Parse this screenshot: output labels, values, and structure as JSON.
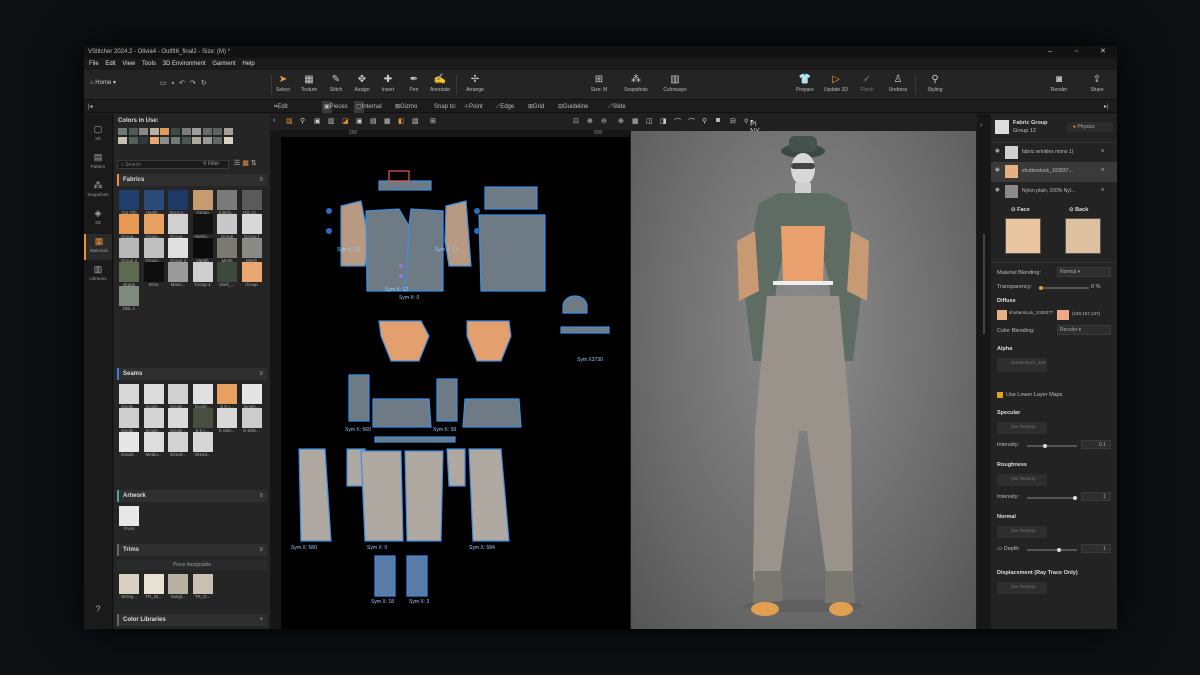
{
  "window": {
    "title": "VStitcher 2024.2 - Olivia4 - Outfit6_final2 - Size: (M) *"
  },
  "menu": [
    "File",
    "Edit",
    "View",
    "Tools",
    "3D Environment",
    "Garment",
    "Help"
  ],
  "toolbar": {
    "home": "Home",
    "tools": [
      {
        "label": "Select",
        "icon": "cursor-icon"
      },
      {
        "label": "Texture",
        "icon": "texture-icon"
      },
      {
        "label": "Stitch",
        "icon": "stitch-icon"
      },
      {
        "label": "Assign",
        "icon": "assign-icon"
      },
      {
        "label": "Insert",
        "icon": "insert-icon"
      },
      {
        "label": "Pen",
        "icon": "pen-icon"
      },
      {
        "label": "Annotate",
        "icon": "annotate-icon"
      },
      {
        "label": "Arrange",
        "icon": "arrange-icon"
      }
    ],
    "right_tools": [
      {
        "label": "Size: M",
        "icon": "size-icon"
      },
      {
        "label": "Snapshots",
        "icon": "snapshots-icon"
      },
      {
        "label": "Colorways",
        "icon": "colorways-icon"
      },
      {
        "label": "Prepare",
        "icon": "prepare-icon"
      },
      {
        "label": "Update 3D",
        "icon": "update-icon"
      },
      {
        "label": "Finish",
        "icon": "finish-icon"
      },
      {
        "label": "Undress",
        "icon": "undress-icon"
      },
      {
        "label": "Styling",
        "icon": "styling-icon"
      },
      {
        "label": "Render",
        "icon": "render-icon"
      },
      {
        "label": "Share",
        "icon": "share-icon"
      }
    ]
  },
  "subbar": {
    "edit_points": "Edit Points",
    "pieces": "Pieces",
    "internal": "Internal",
    "gizmo": "Gizmo",
    "snap_to": "Snap to:",
    "point": "Point",
    "edge": "Edge",
    "grid": "Grid",
    "guideline": "Guideline",
    "slide": "Slide"
  },
  "leftbar": [
    {
      "label": "2D",
      "icon": "2d-icon"
    },
    {
      "label": "Pattern",
      "icon": "pattern-icon"
    },
    {
      "label": "Snapshots",
      "icon": "camera-icon"
    },
    {
      "label": "3D",
      "icon": "3d-icon"
    },
    {
      "label": "Materials",
      "icon": "materials-icon"
    },
    {
      "label": "Libraries",
      "icon": "libraries-icon"
    }
  ],
  "library": {
    "colors_title": "Colors in Use:",
    "colors": [
      "#6d7a72",
      "#4d5a55",
      "#8a8a82",
      "#b8b0a4",
      "#e09a5a",
      "#3d4a4a",
      "#7a7f7a",
      "#9aa09a",
      "#6a6a6a",
      "#5a6560",
      "#a8a098",
      "#c8c0b0",
      "#55605c",
      "#2f3a3a",
      "#e8a870",
      "#8d8d8d",
      "#707a76",
      "#4a5652",
      "#b0a898",
      "#9a9a92",
      "#606a66",
      "#d8d0c0"
    ],
    "search_placeholder": "Search",
    "filter": "Filter",
    "fabrics_title": "Fabrics",
    "fabrics": [
      {
        "label": "2x2 Rib",
        "color": "#1e3f6a"
      },
      {
        "label": "Heath...",
        "color": "#2a4a78"
      },
      {
        "label": "Seccor...",
        "color": "#1d3a66"
      },
      {
        "label": "Group",
        "color": "#c89a70"
      },
      {
        "label": "Interlo...",
        "color": "#7a7a7a"
      },
      {
        "label": "Rib 2x...",
        "color": "#5a5a5a"
      },
      {
        "label": "Group...",
        "color": "#e89a55"
      },
      {
        "label": "Group...",
        "color": "#e8a060"
      },
      {
        "label": "Group...",
        "color": "#d0d0d0"
      },
      {
        "label": "Interlo...",
        "color": "#101010"
      },
      {
        "label": "Group",
        "color": "#c8c8c8"
      },
      {
        "label": "Group f",
        "color": "#d8d8d8"
      },
      {
        "label": "Group 2",
        "color": "#b8b8b8"
      },
      {
        "label": "Group...",
        "color": "#c0c0c0"
      },
      {
        "label": "Group 3",
        "color": "#e0e0e0"
      },
      {
        "label": "Heath",
        "color": "#0a0a0a"
      },
      {
        "label": "Mesh",
        "color": "#7a7a72"
      },
      {
        "label": "Mesh",
        "color": "#8a8a84"
      },
      {
        "label": "straps",
        "color": "#5c6a50"
      },
      {
        "label": "trims",
        "color": "#0e0e0e"
      },
      {
        "label": "Mans...",
        "color": "#9a9a9a"
      },
      {
        "label": "Group 4",
        "color": "#cfcfcf"
      },
      {
        "label": "shell_...",
        "color": "#3c4a3c"
      },
      {
        "label": "Group",
        "color": "#e8a870"
      },
      {
        "label": "DBL 1",
        "color": "#7e8a7e"
      }
    ],
    "seams_title": "Seams",
    "seams": [
      {
        "label": "Single...",
        "color": "#d8d8d8"
      },
      {
        "label": "Single...",
        "color": "#dcdcdc"
      },
      {
        "label": "Single...",
        "color": "#d0d0d0"
      },
      {
        "label": "Doubl...",
        "color": "#e0e0e0"
      },
      {
        "label": "S 8 c...",
        "color": "#e8a060"
      },
      {
        "label": "Single...",
        "color": "#e4e4e4"
      },
      {
        "label": "Single...",
        "color": "#cfcfcf"
      },
      {
        "label": "Single...",
        "color": "#d4d4d4"
      },
      {
        "label": "Single...",
        "color": "#dadada"
      },
      {
        "label": "6 8 c...",
        "color": "#4a4e3e"
      },
      {
        "label": "S Stitc...",
        "color": "#d8d8d8"
      },
      {
        "label": "S Stitc...",
        "color": "#cccccc"
      },
      {
        "label": "Doubl...",
        "color": "#e6e6e6"
      },
      {
        "label": "Mediu...",
        "color": "#dddddd"
      },
      {
        "label": "401ed...",
        "color": "#d2d2d2"
      },
      {
        "label": "401ed...",
        "color": "#d6d6d6"
      }
    ],
    "artwork_title": "Artwork",
    "artwork": [
      {
        "label": "Front",
        "color": "#e8e8e8"
      }
    ],
    "trims_title": "Trims",
    "trims_sub": "Piece Assignable",
    "trims": [
      {
        "label": "String...",
        "color": "#d8d0c0"
      },
      {
        "label": "TR_St...",
        "color": "#e8e0d0"
      },
      {
        "label": "Sangl...",
        "color": "#b8b0a0"
      },
      {
        "label": "TR_D...",
        "color": "#c8c0b0"
      }
    ],
    "color_libraries_title": "Color Libraries"
  },
  "pattern_view": {
    "ruler": [
      "250",
      "500"
    ],
    "labels": [
      {
        "text": "Sym X: 12",
        "x": 1
      },
      {
        "text": "Sym X: 13"
      },
      {
        "text": "Sym X: 12"
      },
      {
        "text": "Sym X: 0"
      },
      {
        "text": "Sym X3730"
      },
      {
        "text": "Sym X: 560"
      },
      {
        "text": "Sym X: 58"
      },
      {
        "text": "Sym X: 580"
      },
      {
        "text": "Sym X: 0"
      },
      {
        "text": "Sym X: 584"
      },
      {
        "text": "Sym X: 3"
      },
      {
        "text": "Sym X: 18"
      }
    ]
  },
  "viewport_3d": {
    "camera": "PI NY 3"
  },
  "properties": {
    "fabric_group_title": "Fabric Group",
    "group_name": "Group 12",
    "physics": "Physics",
    "layers": [
      {
        "name": "fabric wrinkles mono 1(",
        "color": "#d0d0d0"
      },
      {
        "name": "shutterstock_103837...",
        "color": "#e8b080"
      },
      {
        "name": "Nylon plain, 100% Nyl...",
        "color": "#8a8a8a"
      }
    ],
    "face": "Face",
    "back": "Back",
    "material_blending_label": "Material Blending:",
    "material_blending": "Normal",
    "transparency_label": "Transparency:",
    "transparency_value": "0",
    "transparency_unit": "%",
    "diffuse": "Diffuse",
    "diffuse_texture": "shutterstock_103837738...",
    "diffuse_rgb": "(240,167,137)",
    "diffuse_color": "#f0a789",
    "color_blending_label": "Color Blending:",
    "color_blending": "Recolor",
    "alpha": "Alpha",
    "alpha_texture": "shutterstock_103837738...",
    "use_lower_layer_maps": "Use Lower Layer Maps",
    "specular": "Specular",
    "no_texture": "(No Texture)",
    "intensity_label": "Intensity:",
    "specular_intensity": "0.1",
    "roughness": "Roughness",
    "roughness_intensity": "1",
    "normal": "Normal",
    "depth_label": "Depth:",
    "depth_value": "1",
    "displacement": "Displacement (Ray Trace Only)"
  }
}
